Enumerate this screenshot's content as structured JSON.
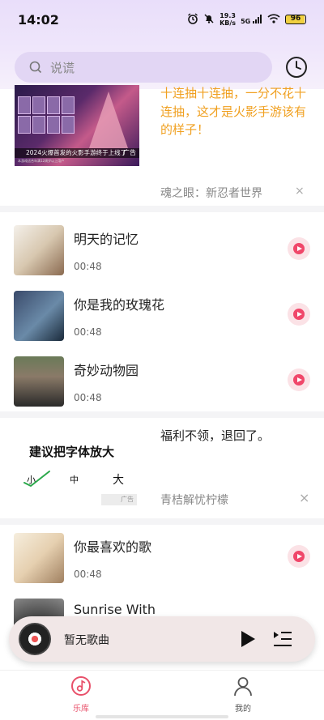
{
  "status_bar": {
    "time": "14:02",
    "net_speed_value": "19.3",
    "net_speed_unit": "KB/s",
    "signal_label": "5G",
    "battery": "96"
  },
  "search": {
    "placeholder": "说谎"
  },
  "ad_top": {
    "image_caption": "2024火爆首发的火影手游终于上线了",
    "image_subcaption": "本游戏适合年满12周岁以上用户",
    "image_tag": "广告",
    "headline": "十连抽十连抽，一分不花十连抽，这才是火影手游该有的样子！",
    "source": "魂之眼：新忍者世界",
    "close_symbol": "×"
  },
  "songs": [
    {
      "title": "明天的记忆",
      "duration": "00:48"
    },
    {
      "title": "你是我的玫瑰花",
      "duration": "00:48"
    },
    {
      "title": "奇妙动物园",
      "duration": "00:48"
    },
    {
      "title": "你最喜欢的歌",
      "duration": "00:48"
    },
    {
      "title": "Sunrise With",
      "duration": ""
    }
  ],
  "ad_middle": {
    "headline": "福利不领，退回了。",
    "font_title": "建议把字体放大",
    "size_small": "小",
    "size_medium": "中",
    "size_large": "大",
    "logo_tag": "广告",
    "source": "青桔解忧柠檬",
    "close_symbol": "×"
  },
  "player": {
    "now_playing": "暂无歌曲"
  },
  "nav": {
    "library": "乐库",
    "profile": "我的"
  },
  "colors": {
    "accent": "#e8506a",
    "ad_headline": "#f0a020",
    "search_bg": "#e2d6f4",
    "player_bg": "#f1e7e7"
  }
}
